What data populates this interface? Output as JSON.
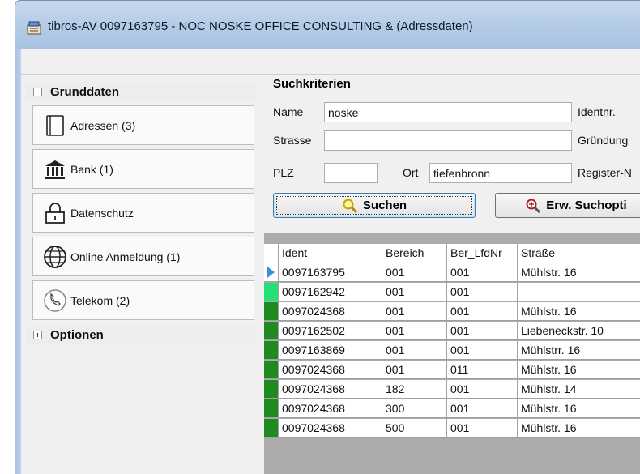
{
  "window": {
    "title": "tibros-AV 0097163795 - NOC NOSKE OFFICE CONSULTING &  (Adressdaten)"
  },
  "nav": {
    "group_main": "Grunddaten",
    "group_options": "Optionen",
    "items": [
      {
        "label": "Adressen (3)",
        "icon": "address-book-icon"
      },
      {
        "label": "Bank (1)",
        "icon": "bank-icon"
      },
      {
        "label": "Datenschutz",
        "icon": "lock-icon"
      },
      {
        "label": "Online Anmeldung (1)",
        "icon": "globe-icon"
      },
      {
        "label": "Telekom (2)",
        "icon": "phone-icon"
      }
    ]
  },
  "search": {
    "header": "Suchkriterien",
    "name_label": "Name",
    "name_value": "noske",
    "strasse_label": "Strasse",
    "strasse_value": "",
    "plz_label": "PLZ",
    "plz_value": "",
    "ort_label": "Ort",
    "ort_value": "tiefenbronn",
    "identnr_label": "Identnr.",
    "gruendung_label": "Gründung",
    "register_label": "Register-N",
    "search_button": "Suchen",
    "ext_button": "Erw. Suchopti"
  },
  "grid": {
    "columns": [
      "Ident",
      "Bereich",
      "Ber_LfdNr",
      "Straße"
    ],
    "rows": [
      {
        "ident": "0097163795",
        "bereich": "001",
        "lfdnr": "001",
        "strasse": "Mühlstr. 16",
        "marker": "current"
      },
      {
        "ident": "0097162942",
        "bereich": "001",
        "lfdnr": "001",
        "strasse": "",
        "marker": "light-green"
      },
      {
        "ident": "0097024368",
        "bereich": "001",
        "lfdnr": "001",
        "strasse": "Mühlstr. 16",
        "marker": "green"
      },
      {
        "ident": "0097162502",
        "bereich": "001",
        "lfdnr": "001",
        "strasse": "Liebeneckstr. 10",
        "marker": "green"
      },
      {
        "ident": "0097163869",
        "bereich": "001",
        "lfdnr": "001",
        "strasse": "Mühlstrr. 16",
        "marker": "green"
      },
      {
        "ident": "0097024368",
        "bereich": "001",
        "lfdnr": "011",
        "strasse": "Mühlstr. 16",
        "marker": "green"
      },
      {
        "ident": "0097024368",
        "bereich": "182",
        "lfdnr": "001",
        "strasse": "Mühlstr. 14",
        "marker": "green"
      },
      {
        "ident": "0097024368",
        "bereich": "300",
        "lfdnr": "001",
        "strasse": "Mühlstr. 16",
        "marker": "green"
      },
      {
        "ident": "0097024368",
        "bereich": "500",
        "lfdnr": "001",
        "strasse": "Mühlstr. 16",
        "marker": "green"
      }
    ]
  },
  "colors": {
    "marker_green": "#1f8a1f",
    "marker_light_green": "#22e07a",
    "current_arrow": "#3a8fd8"
  }
}
